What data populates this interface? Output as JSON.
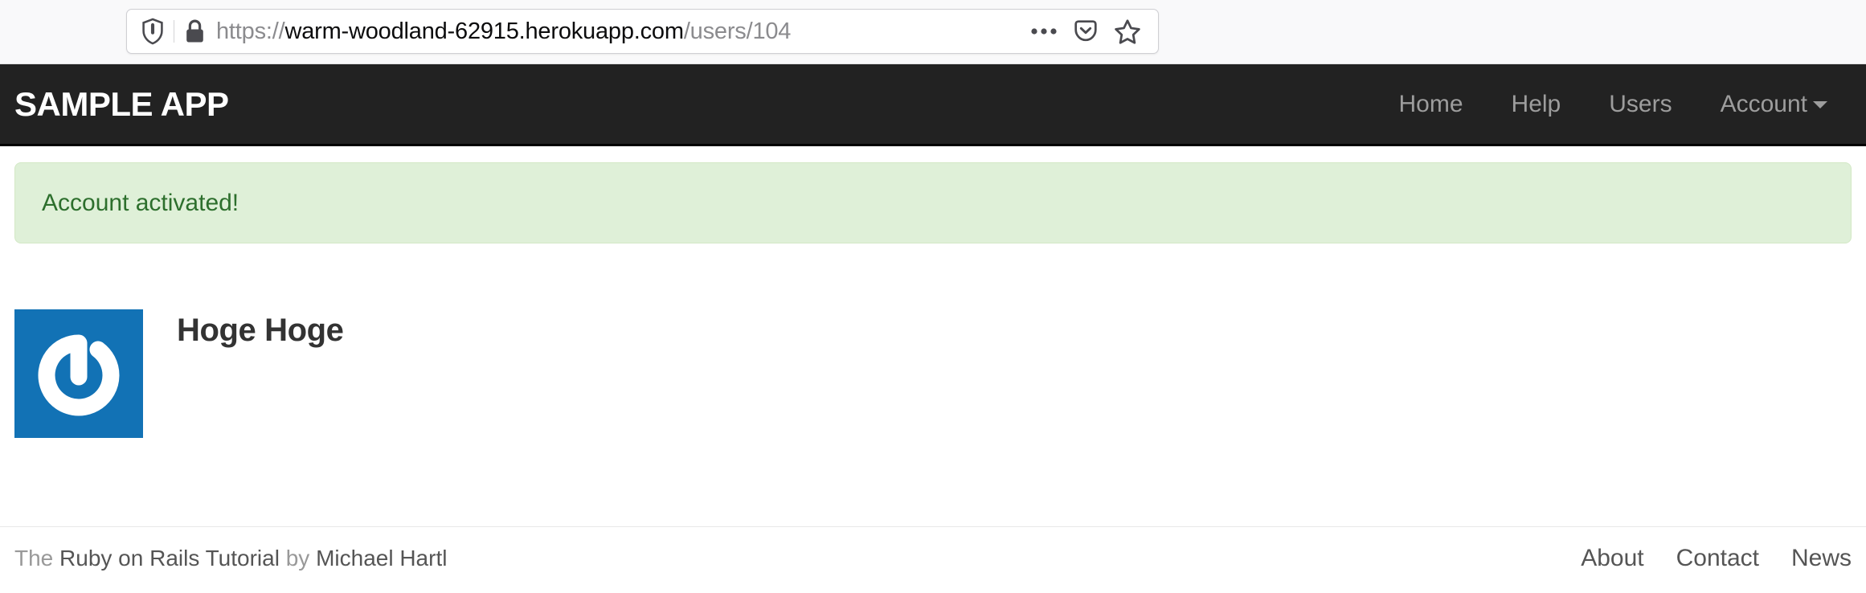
{
  "browser": {
    "shield_icon": "shield-icon",
    "lock_icon": "lock-icon",
    "url": {
      "scheme": "https://",
      "host": "warm-woodland-62915.herokuapp.com",
      "path": "/users/104",
      "full": "https://warm-woodland-62915.herokuapp.com/users/104"
    },
    "actions": [
      {
        "name": "page-actions-icon",
        "label": "•••"
      },
      {
        "name": "pocket-icon",
        "label": "Pocket"
      },
      {
        "name": "bookmark-star-icon",
        "label": "Bookmark"
      }
    ]
  },
  "navbar": {
    "brand": "SAMPLE APP",
    "links": [
      {
        "label": "Home",
        "caret": false
      },
      {
        "label": "Help",
        "caret": false
      },
      {
        "label": "Users",
        "caret": false
      },
      {
        "label": "Account",
        "caret": true
      }
    ]
  },
  "alert": {
    "message": "Account activated!",
    "type": "success",
    "bg_color": "#dff0d8",
    "text_color": "#2d6f2d"
  },
  "user": {
    "name": "Hoge Hoge",
    "gravatar_alt": "Hoge Hoge",
    "gravatar_bg": "#1272b5"
  },
  "footer": {
    "credit_prefix": "The ",
    "credit_link_1": "Ruby on Rails Tutorial",
    "credit_middle": " by ",
    "credit_link_2": "Michael Hartl",
    "links": [
      {
        "label": "About"
      },
      {
        "label": "Contact"
      },
      {
        "label": "News"
      }
    ]
  }
}
